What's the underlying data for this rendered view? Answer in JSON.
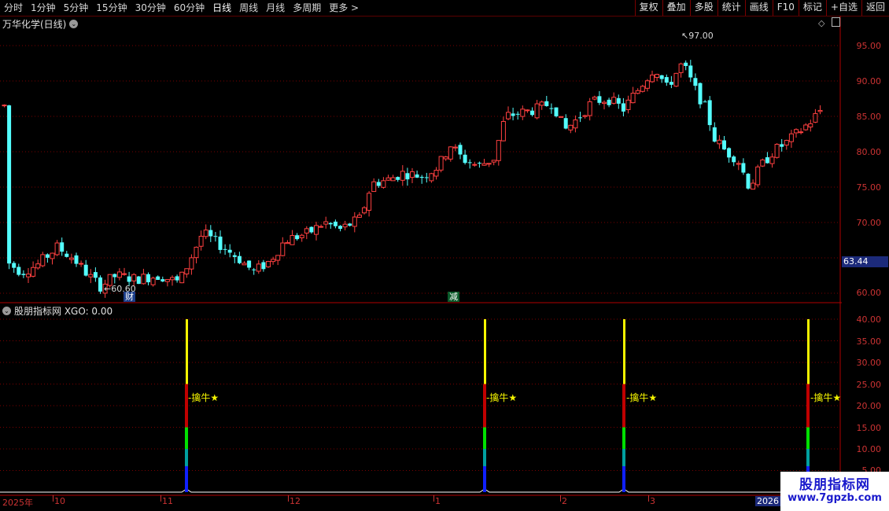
{
  "toolbar": {
    "tabs": [
      "分时",
      "1分钟",
      "5分钟",
      "15分钟",
      "30分钟",
      "60分钟",
      "日线",
      "周线",
      "月线",
      "多周期",
      "更多 >"
    ],
    "buttons": [
      "复权",
      "叠加",
      "多股",
      "统计",
      "画线",
      "F10",
      "标记",
      "+自选",
      "返回"
    ]
  },
  "main_panel": {
    "title": "万华化学(日线)",
    "price_axis": [
      "95.00",
      "90.00",
      "85.00",
      "80.00",
      "75.00",
      "70.00",
      "60.00"
    ],
    "current_price": "63.44",
    "high_annotation": "97.00",
    "low_annotation": "60.60",
    "badge_cai": "财",
    "badge_jian": "减"
  },
  "indicator_panel": {
    "title": "股朋指标网 XGO: 0.00",
    "axis": [
      "40.00",
      "35.00",
      "30.00",
      "25.00",
      "20.00",
      "15.00",
      "10.00",
      "5.00"
    ],
    "signal_label": "-擒牛★"
  },
  "date_axis": [
    "2025年",
    "10",
    "11",
    "12",
    "1",
    "2",
    "3",
    "2026"
  ],
  "watermark": {
    "title": "股朋指标网",
    "url": "www.7gpzb.com"
  },
  "colors": {
    "up": "#ff4040",
    "down": "#54ffff",
    "grid": "#7a0000",
    "signal_yellow": "#f6f600",
    "signal_red": "#c00000",
    "signal_green": "#00e000",
    "signal_blue": "#1020ff"
  }
}
